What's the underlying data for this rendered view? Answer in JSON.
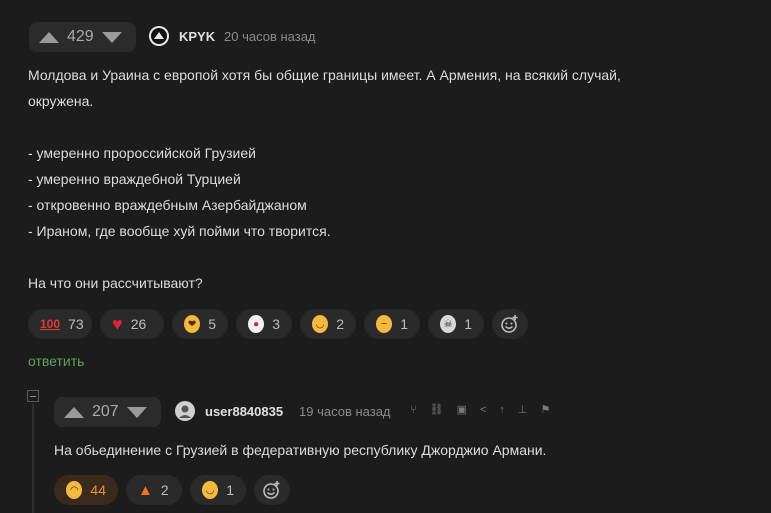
{
  "comment1": {
    "rating": "429",
    "author": "KPYK",
    "time": "20 часов назад",
    "lines": [
      "Молдова и Ураина с европой хотя бы общие границы имеет. А Армения, на всякий случай,",
      "окружена.",
      "- умеренно пророссийской Грузией",
      "- умеренно враждебной Турцией",
      "- откровенно враждебным Азербайджаном",
      "- Ираном, где вообще хуй пойми что творится.",
      "На что они рассчитывают?"
    ],
    "reactions": [
      {
        "icon": "hundred-points-icon",
        "count": "73"
      },
      {
        "icon": "heart-icon",
        "count": "26"
      },
      {
        "icon": "hearts-face-icon",
        "count": "5"
      },
      {
        "icon": "clown-face-icon",
        "count": "3"
      },
      {
        "icon": "grin-face-icon",
        "count": "2"
      },
      {
        "icon": "thinking-face-icon",
        "count": "1"
      },
      {
        "icon": "skull-icon",
        "count": "1"
      }
    ],
    "reply_label": "ответить"
  },
  "comment2": {
    "rating": "207",
    "author": "user8840835",
    "time": "19 часов назад",
    "text": "На обьединение с Грузией в федеративную республику Джорджио Армани.",
    "reactions": [
      {
        "icon": "laughing-face-icon",
        "count": "44",
        "active": true
      },
      {
        "icon": "fire-icon",
        "count": "2"
      },
      {
        "icon": "grin-face-icon",
        "count": "1"
      }
    ]
  },
  "colors": {
    "background": "#1c1c1c",
    "reply_green": "#5aa75a",
    "active_count": "#e09040"
  }
}
